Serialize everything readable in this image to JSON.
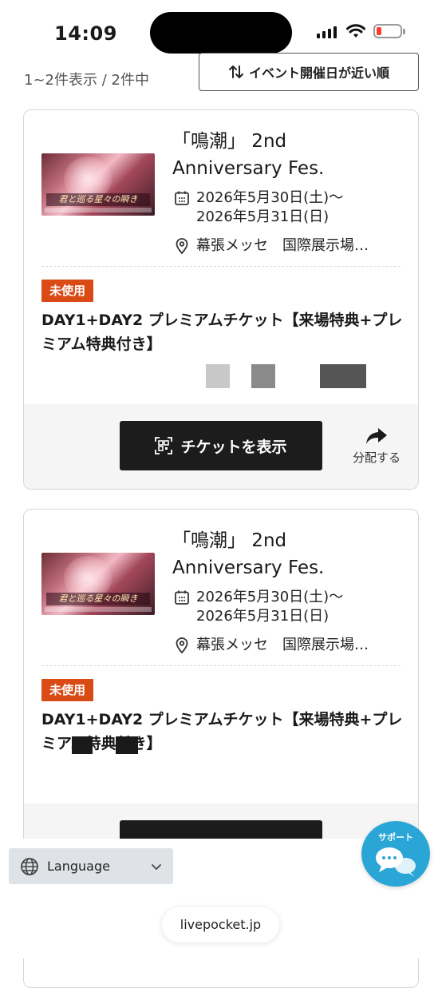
{
  "status_bar": {
    "time": "14:09",
    "battery_color": "#ff3b30"
  },
  "list": {
    "count_text": "1~2件表示 / 2件中",
    "sort_label": "イベント開催日が近い順"
  },
  "tickets": [
    {
      "title_line1": "「鳴潮」 2nd",
      "title_line2": "Anniversary Fes.",
      "date_line1": "2026年5月30日(土)〜",
      "date_line2": "2026年5月31日(日)",
      "venue": "幕張メッセ　国際展示場…",
      "thumbnail_text": "君と巡る星々の瞬き",
      "status_badge": "未使用",
      "ticket_name": "DAY1+DAY2 プレミアムチケット【来場特典+プレミアム特典付き】",
      "show_button_label": "チケットを表示",
      "distribute_label": "分配する"
    },
    {
      "title_line1": "「鳴潮」 2nd",
      "title_line2": "Anniversary Fes.",
      "date_line1": "2026年5月30日(土)〜",
      "date_line2": "2026年5月31日(日)",
      "venue": "幕張メッセ　国際展示場…",
      "thumbnail_text": "君と巡る星々の瞬き",
      "status_badge": "未使用",
      "ticket_name": "DAY1+DAY2 プレミアムチケット【来場特典+プレミアム特典付き】"
    }
  ],
  "footer": {
    "language_label": "Language",
    "support_label": "サポート",
    "url": "livepocket.jp"
  },
  "colors": {
    "badge": "#d94a15",
    "button": "#1c1c1c",
    "support": "#2aa6d6"
  }
}
